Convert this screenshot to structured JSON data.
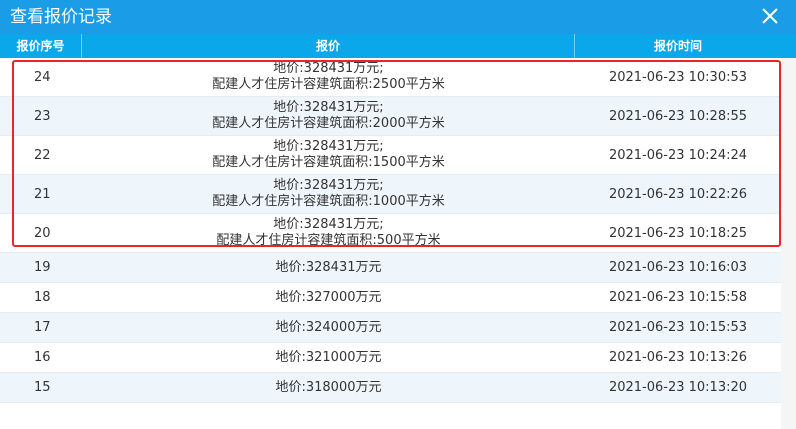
{
  "window": {
    "title": "查看报价记录",
    "close_icon": "close-icon"
  },
  "table": {
    "headers": {
      "seq": "报价序号",
      "price": "报价",
      "time": "报价时间"
    },
    "rows": [
      {
        "seq": "24",
        "price": "地价:328431万元;",
        "extra": "配建人才住房计容建筑面积:2500平方米",
        "time": "2021-06-23 10:30:53"
      },
      {
        "seq": "23",
        "price": "地价:328431万元;",
        "extra": "配建人才住房计容建筑面积:2000平方米",
        "time": "2021-06-23 10:28:55"
      },
      {
        "seq": "22",
        "price": "地价:328431万元;",
        "extra": "配建人才住房计容建筑面积:1500平方米",
        "time": "2021-06-23 10:24:24"
      },
      {
        "seq": "21",
        "price": "地价:328431万元;",
        "extra": "配建人才住房计容建筑面积:1000平方米",
        "time": "2021-06-23 10:22:26"
      },
      {
        "seq": "20",
        "price": "地价:328431万元;",
        "extra": "配建人才住房计容建筑面积:500平方米",
        "time": "2021-06-23 10:18:25"
      },
      {
        "seq": "19",
        "price": "地价:328431万元",
        "time": "2021-06-23 10:16:03"
      },
      {
        "seq": "18",
        "price": "地价:327000万元",
        "time": "2021-06-23 10:15:58"
      },
      {
        "seq": "17",
        "price": "地价:324000万元",
        "time": "2021-06-23 10:15:53"
      },
      {
        "seq": "16",
        "price": "地价:321000万元",
        "time": "2021-06-23 10:13:26"
      },
      {
        "seq": "15",
        "price": "地价:318000万元",
        "time": "2021-06-23 10:13:20"
      }
    ]
  },
  "colors": {
    "titlebar": "#1a9ce6",
    "header": "#0aa8ea",
    "highlight": "#e8262a"
  }
}
